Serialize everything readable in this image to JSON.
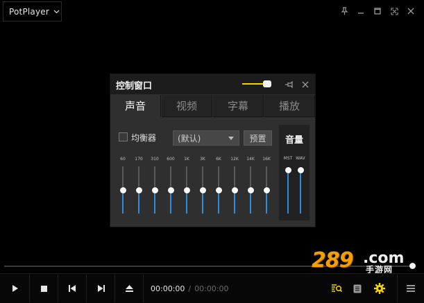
{
  "app": {
    "name": "PotPlayer"
  },
  "window_controls": [
    {
      "name": "pin-icon"
    },
    {
      "name": "minimize-icon"
    },
    {
      "name": "maximize-icon"
    },
    {
      "name": "fullscreen-icon"
    },
    {
      "name": "close-icon"
    }
  ],
  "control_panel": {
    "title": "控制窗口",
    "opacity_level": 0.85,
    "tabs": [
      {
        "label": "声音",
        "active": true
      },
      {
        "label": "视频",
        "active": false
      },
      {
        "label": "字幕",
        "active": false
      },
      {
        "label": "播放",
        "active": false
      }
    ],
    "equalizer": {
      "enable_label": "均衡器",
      "enabled": false,
      "preset_value": "(默认)",
      "preset_button": "预置",
      "bands": [
        {
          "label": "60",
          "level": 0.5
        },
        {
          "label": "170",
          "level": 0.5
        },
        {
          "label": "310",
          "level": 0.5
        },
        {
          "label": "600",
          "level": 0.5
        },
        {
          "label": "1K",
          "level": 0.5
        },
        {
          "label": "3K",
          "level": 0.5
        },
        {
          "label": "6K",
          "level": 0.5
        },
        {
          "label": "12K",
          "level": 0.5
        },
        {
          "label": "14K",
          "level": 0.5
        },
        {
          "label": "16K",
          "level": 0.5
        }
      ]
    },
    "volume": {
      "title": "音量",
      "channels": [
        {
          "label": "MST",
          "level": 0.95
        },
        {
          "label": "WAV",
          "level": 0.95
        }
      ]
    }
  },
  "playback": {
    "position_fraction": 1.0,
    "current_time": "00:00:00",
    "separator": "/",
    "total_time": "00:00:00"
  },
  "colors": {
    "accent_yellow": "#f3d500",
    "eq_blue": "#2a8fe0",
    "background": "#000000",
    "panel": "#2f2f2f"
  },
  "watermark": {
    "digits": "289",
    "suffix": ".com",
    "sub": "手游网"
  }
}
